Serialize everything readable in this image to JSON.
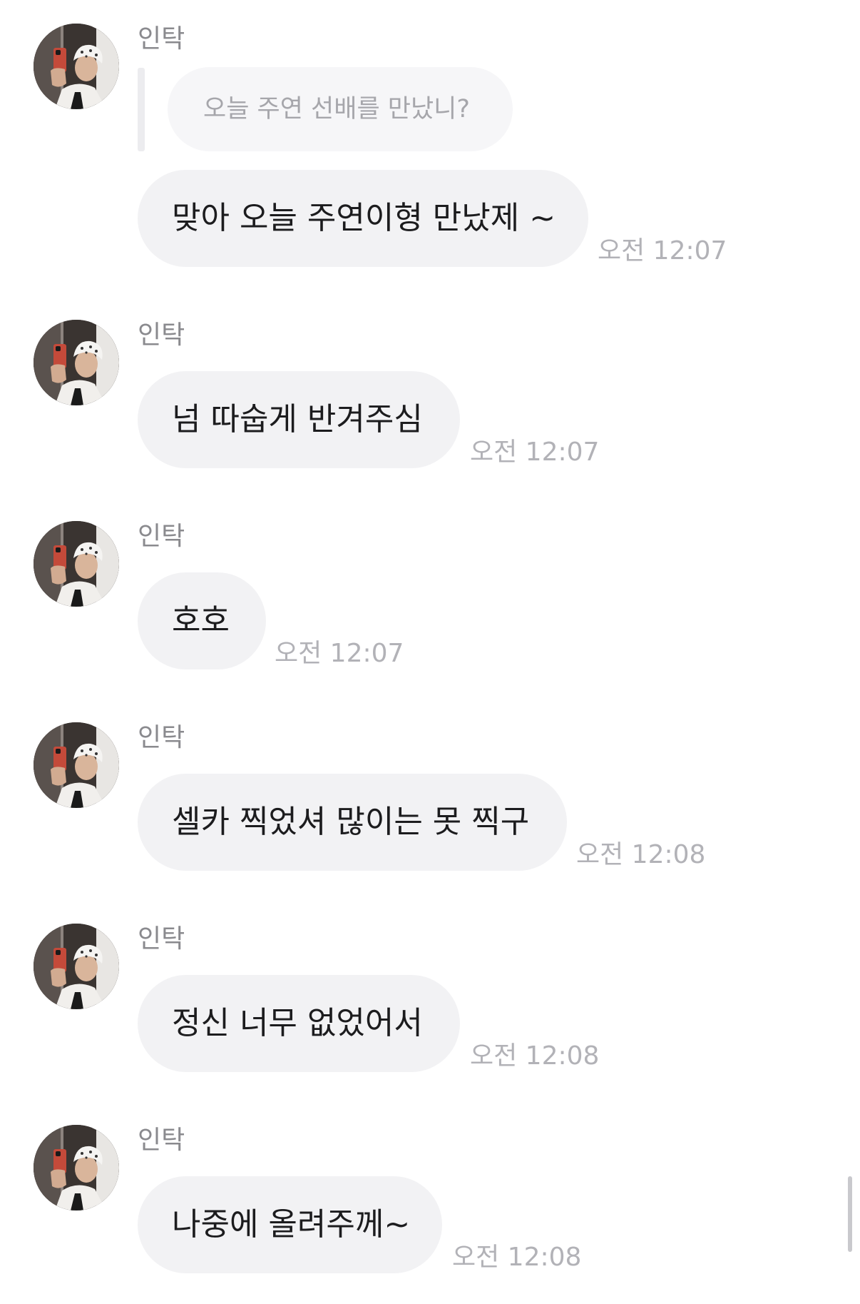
{
  "messages": [
    {
      "sender": "인탁",
      "quoted_text": "오늘 주연 선배를 만났니?",
      "text": "맞아 오늘 주연이형 만났제 ~",
      "time": "오전 12:07"
    },
    {
      "sender": "인탁",
      "text": "넘 따숩게 반겨주심",
      "time": "오전 12:07"
    },
    {
      "sender": "인탁",
      "text": "호호",
      "time": "오전 12:07"
    },
    {
      "sender": "인탁",
      "text": "셀카 찍었셔 많이는 못 찍구",
      "time": "오전 12:08"
    },
    {
      "sender": "인탁",
      "text": "정신 너무 없었어서",
      "time": "오전 12:08"
    },
    {
      "sender": "인탁",
      "text": "나중에 올려주께~",
      "time": "오전 12:08"
    }
  ],
  "avatar_icon": "profile-photo",
  "colors": {
    "bubble": "#f2f2f4",
    "quote_bubble": "#f6f6f8",
    "time_text": "#b2b2b7",
    "sender_text": "#8a8a8e"
  }
}
